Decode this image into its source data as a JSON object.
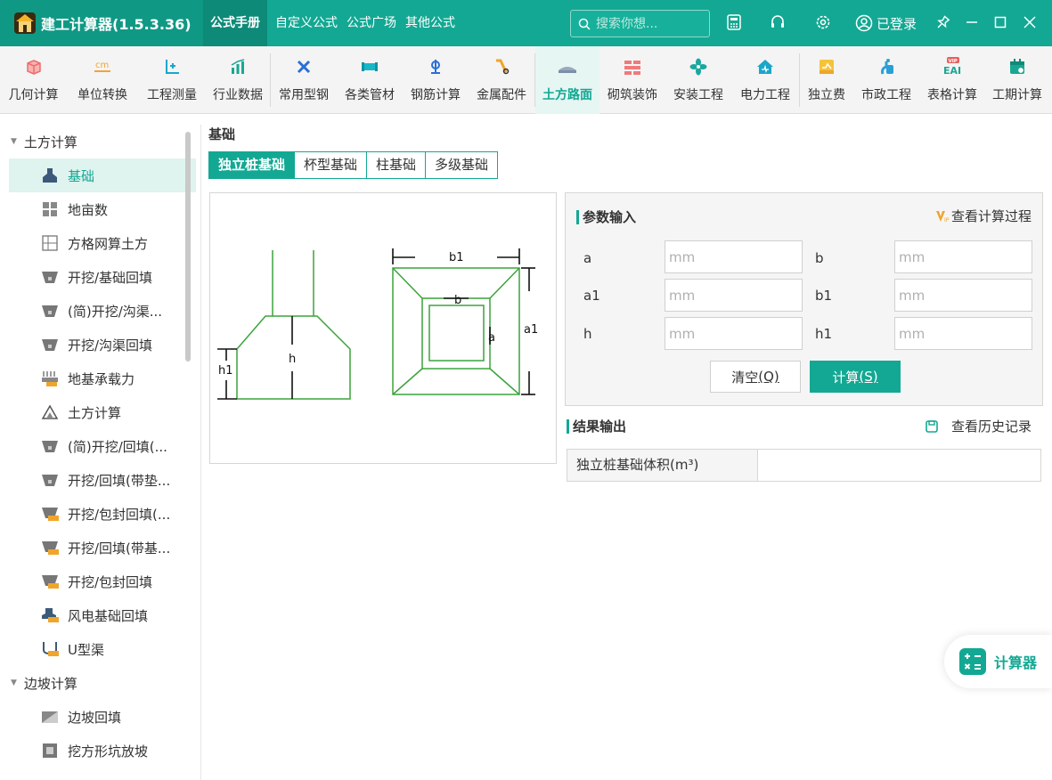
{
  "app": {
    "title": "建工计算器(1.5.3.36)"
  },
  "top_nav": [
    {
      "label": "公式手册"
    },
    {
      "label": "自定义公式"
    },
    {
      "label": "公式广场"
    },
    {
      "label": "其他公式"
    }
  ],
  "search": {
    "placeholder": "搜索你想..."
  },
  "login": {
    "label": "已登录"
  },
  "toolbar": [
    {
      "label": "几何计算",
      "icon": "cube-icon",
      "color": "#f07a7a"
    },
    {
      "label": "单位转换",
      "icon": "cm-icon",
      "color": "#f2a33a"
    },
    {
      "label": "工程测量",
      "icon": "axis-icon",
      "color": "#19a7c9"
    },
    {
      "label": "行业数据",
      "icon": "bar-chart-icon",
      "color": "#19a793"
    },
    {
      "label": "常用型钢",
      "icon": "tools-icon",
      "color": "#2a6fd6"
    },
    {
      "label": "各类管材",
      "icon": "pipe-icon",
      "color": "#18b7c8"
    },
    {
      "label": "钢筋计算",
      "icon": "rebar-icon",
      "color": "#2a6fd6"
    },
    {
      "label": "金属配件",
      "icon": "wrench-icon",
      "color": "#f0a52a"
    },
    {
      "label": "土方路面",
      "icon": "road-icon",
      "color": "#7b8fa8"
    },
    {
      "label": "砌筑装饰",
      "icon": "brick-icon",
      "color": "#f07a7a"
    },
    {
      "label": "安装工程",
      "icon": "fan-icon",
      "color": "#19a7a0"
    },
    {
      "label": "电力工程",
      "icon": "house-power-icon",
      "color": "#19a7c9"
    },
    {
      "label": "独立费",
      "icon": "money-icon",
      "color": "#f5b52a"
    },
    {
      "label": "市政工程",
      "icon": "faucet-icon",
      "color": "#2a9fd6"
    },
    {
      "label": "表格计算",
      "icon": "vip-table-icon",
      "color": "#19a793"
    },
    {
      "label": "工期计算",
      "icon": "calendar-icon",
      "color": "#19a793"
    }
  ],
  "toolbar_active": "土方路面",
  "sidebar": {
    "groups": [
      {
        "label": "土方计算",
        "items": [
          {
            "label": "基础",
            "icon": "foundation-icon",
            "active": true
          },
          {
            "label": "地亩数",
            "icon": "land-icon"
          },
          {
            "label": "方格网算土方",
            "icon": "grid-icon"
          },
          {
            "label": "开挖/基础回填",
            "icon": "trench-icon"
          },
          {
            "label": "(简)开挖/沟渠...",
            "icon": "trench-icon"
          },
          {
            "label": "开挖/沟渠回填",
            "icon": "trench-icon"
          },
          {
            "label": "地基承载力",
            "icon": "vip-load-icon"
          },
          {
            "label": "土方计算",
            "icon": "mountain-icon"
          },
          {
            "label": "(简)开挖/回填(...",
            "icon": "trench-icon"
          },
          {
            "label": "开挖/回填(带垫...",
            "icon": "trench-icon"
          },
          {
            "label": "开挖/包封回填(...",
            "icon": "vip-trench-icon"
          },
          {
            "label": "开挖/回填(带基...",
            "icon": "vip-trench-icon"
          },
          {
            "label": "开挖/包封回填",
            "icon": "vip-trench-icon"
          },
          {
            "label": "风电基础回填",
            "icon": "vip-wind-icon"
          },
          {
            "label": "U型渠",
            "icon": "vip-u-channel-icon"
          }
        ]
      },
      {
        "label": "边坡计算",
        "items": [
          {
            "label": "边坡回填",
            "icon": "slope-icon"
          },
          {
            "label": "挖方形坑放坡",
            "icon": "pit-icon"
          }
        ]
      }
    ]
  },
  "main": {
    "section_title": "基础",
    "tabs": [
      {
        "label": "独立桩基础",
        "active": true
      },
      {
        "label": "杯型基础"
      },
      {
        "label": "柱基础"
      },
      {
        "label": "多级基础"
      }
    ],
    "diagram": {
      "labels": {
        "h1": "h1",
        "h": "h",
        "b1": "b1",
        "b": "b",
        "a": "a",
        "a1": "a1"
      },
      "line_color": "#3aa33a"
    },
    "params": {
      "heading": "参数输入",
      "view_process": "查看计算过程",
      "fields": [
        {
          "label": "a",
          "placeholder": "mm",
          "value": ""
        },
        {
          "label": "b",
          "placeholder": "mm",
          "value": ""
        },
        {
          "label": "a1",
          "placeholder": "mm",
          "value": ""
        },
        {
          "label": "b1",
          "placeholder": "mm",
          "value": ""
        },
        {
          "label": "h",
          "placeholder": "mm",
          "value": ""
        },
        {
          "label": "h1",
          "placeholder": "mm",
          "value": ""
        }
      ],
      "clear_label": "清空",
      "clear_key": "(Q)",
      "calc_label": "计算",
      "calc_key": "(S)"
    },
    "result": {
      "heading": "结果输出",
      "history_label": "查看历史记录",
      "rows": [
        {
          "label": "独立桩基础体积(m³)",
          "value": ""
        }
      ]
    }
  },
  "floating_calc": {
    "label": "计算器"
  },
  "colors": {
    "accent": "#13a893",
    "accent_dark": "#0f9985"
  }
}
